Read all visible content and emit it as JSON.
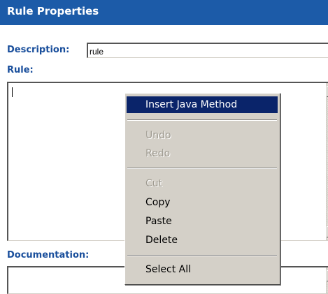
{
  "panel": {
    "title": "Rule Properties"
  },
  "form": {
    "description_label": "Description:",
    "description_value": "rule",
    "rule_label": "Rule:",
    "rule_value": "",
    "documentation_label": "Documentation:"
  },
  "context_menu": {
    "items": [
      {
        "label": "Insert Java Method",
        "state": "selected"
      },
      {
        "label": "Undo",
        "state": "disabled"
      },
      {
        "label": "Redo",
        "state": "disabled"
      },
      {
        "label": "Cut",
        "state": "disabled"
      },
      {
        "label": "Copy",
        "state": "enabled"
      },
      {
        "label": "Paste",
        "state": "enabled"
      },
      {
        "label": "Delete",
        "state": "enabled"
      },
      {
        "label": "Select All",
        "state": "enabled"
      }
    ]
  },
  "colors": {
    "title_bar": "#1c5ba8",
    "label_text": "#1a4f9c",
    "menu_bg": "#d4d0c8",
    "menu_highlight": "#0a246a"
  },
  "icons": {
    "scroll_up": "scroll-up-arrow-icon",
    "scroll_down": "scroll-down-arrow-icon"
  }
}
